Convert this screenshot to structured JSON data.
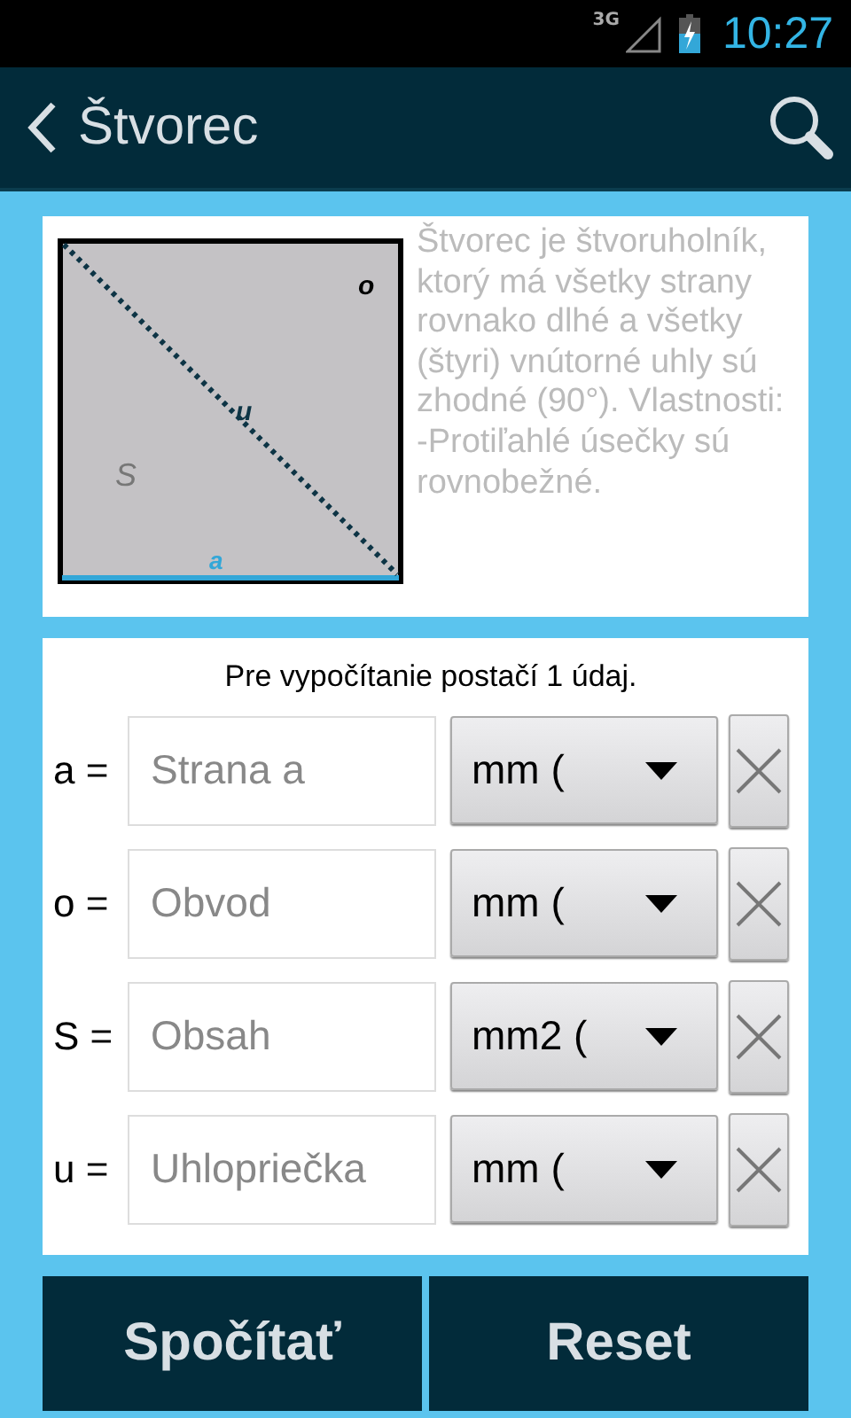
{
  "status_bar": {
    "network": "3G",
    "time": "10:27"
  },
  "action_bar": {
    "title": "Štvorec"
  },
  "diagram": {
    "labels": [
      {
        "kind": "perimeter",
        "text": "o"
      },
      {
        "kind": "diagonal",
        "text": "u"
      },
      {
        "kind": "area",
        "text": "S"
      },
      {
        "kind": "side",
        "text": "a"
      }
    ]
  },
  "description": "Štvorec je štvoruholník, ktorý má všetky strany rovnako dlhé a všetky (štyri) vnútorné uhly sú zhodné (90°). Vlastnosti: -Protiľahlé úsečky sú rovnobežné.",
  "hint": "Pre vypočítanie postačí 1 údaj.",
  "rows": [
    {
      "label": "a =",
      "placeholder": "Strana a",
      "unit": "mm ("
    },
    {
      "label": "o =",
      "placeholder": "Obvod",
      "unit": "mm ("
    },
    {
      "label": "S =",
      "placeholder": "Obsah",
      "unit": "mm2 ("
    },
    {
      "label": "u =",
      "placeholder": "Uhlopriečka",
      "unit": "mm ("
    }
  ],
  "buttons": [
    "Spočítať",
    "Reset"
  ]
}
